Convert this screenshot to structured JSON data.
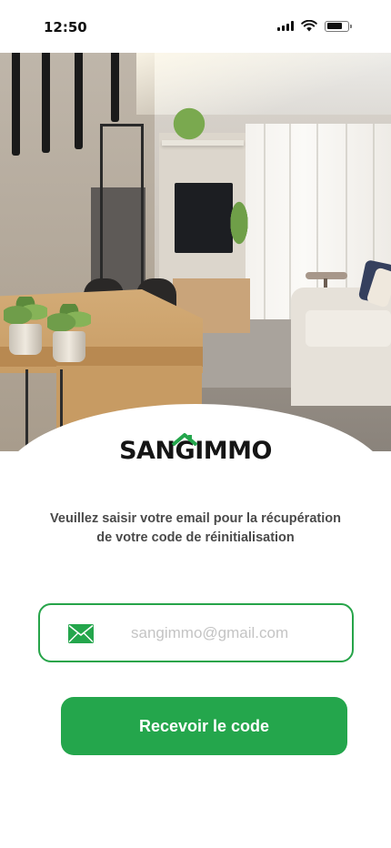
{
  "status_bar": {
    "time": "12:50",
    "signal_icon": "cellular-signal-icon",
    "wifi_icon": "wifi-icon",
    "battery_icon": "battery-icon"
  },
  "hero": {
    "image": "living-room-interior-photo"
  },
  "brand": {
    "logo_prefix": "SAN",
    "logo_g": "G",
    "logo_suffix": "IMMO",
    "roof_icon": "house-roof-icon",
    "accent_color": "#24a64c"
  },
  "instructions": {
    "line1": "Veuillez saisir votre email pour la récupération",
    "line2": "de votre code de réinitialisation"
  },
  "email_field": {
    "icon": "envelope-icon",
    "value": "",
    "placeholder": "sangimmo@gmail.com"
  },
  "submit": {
    "label": "Recevoir le code"
  }
}
